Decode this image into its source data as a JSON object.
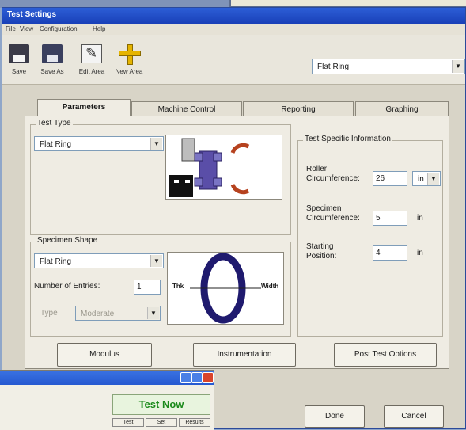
{
  "window": {
    "title": "Test Settings"
  },
  "menu": [
    "File",
    "View",
    "Configuration",
    "Help"
  ],
  "toolbar": {
    "buttons": [
      {
        "label": "Save",
        "icon": "floppy-disk-icon"
      },
      {
        "label": "Save As",
        "icon": "floppy-disks-icon"
      },
      {
        "label": "Edit Area",
        "icon": "edit-area-icon"
      },
      {
        "label": "New Area",
        "icon": "new-area-plus-icon"
      }
    ],
    "test_selector_value": "Flat Ring"
  },
  "tabs": [
    "Parameters",
    "Machine Control",
    "Reporting",
    "Graphing"
  ],
  "active_tab": "Parameters",
  "test_type": {
    "title": "Test Type",
    "value": "Flat Ring"
  },
  "specimen_shape": {
    "title": "Specimen Shape",
    "value": "Flat Ring",
    "entries_label": "Number of Entries:",
    "entries_value": "1",
    "type_label": "Type",
    "type_value": "Moderate",
    "diagram_labels": {
      "thick": "Thk",
      "width": "Width"
    }
  },
  "test_specific": {
    "title": "Test Specific Information",
    "roller_label": "Roller\nCircumference:",
    "roller_value": "26",
    "roller_unit": "in",
    "specimen_label": "Specimen\nCircumference:",
    "specimen_value": "5",
    "specimen_unit": "in",
    "start_label": "Starting\nPosition:",
    "start_value": "4",
    "start_unit": "in"
  },
  "buttons": {
    "modulus": "Modulus",
    "instrumentation": "Instrumentation",
    "post_test": "Post Test Options",
    "done": "Done",
    "cancel": "Cancel"
  },
  "overlap_window": {
    "test_now": "Test Now",
    "small_buttons": [
      "Test",
      "Set",
      "Results"
    ]
  },
  "colors": {
    "title_blue": "#1f4bc6",
    "test_now_green": "#1b8a1b",
    "ring_purple": "#1f1a6e"
  }
}
